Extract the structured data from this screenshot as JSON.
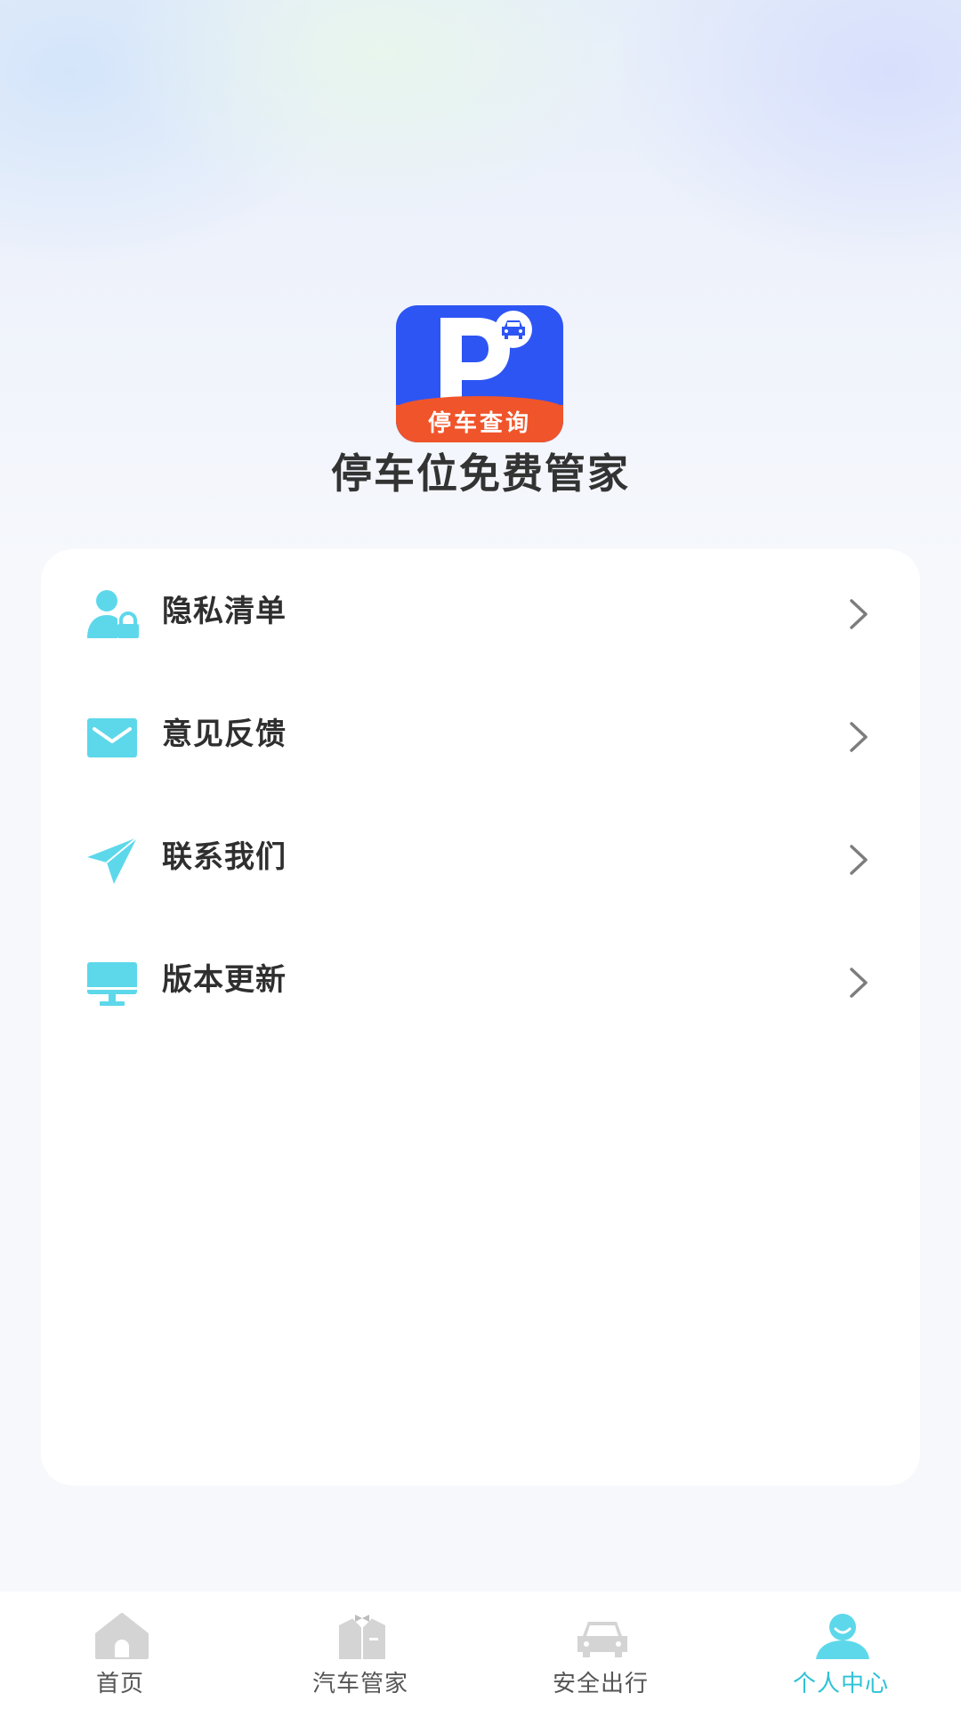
{
  "header": {
    "logo_text": "停车查询",
    "app_name": "停车位免费管家"
  },
  "menu": {
    "items": [
      {
        "label": "隐私清单",
        "icon": "privacy-user-lock-icon"
      },
      {
        "label": "意见反馈",
        "icon": "mail-envelope-icon"
      },
      {
        "label": "联系我们",
        "icon": "paper-plane-icon"
      },
      {
        "label": "版本更新",
        "icon": "monitor-icon"
      }
    ]
  },
  "tab_bar": {
    "tabs": [
      {
        "label": "首页",
        "icon": "home-icon",
        "active": false
      },
      {
        "label": "汽车管家",
        "icon": "butler-suit-icon",
        "active": false
      },
      {
        "label": "安全出行",
        "icon": "car-icon",
        "active": false
      },
      {
        "label": "个人中心",
        "icon": "person-icon",
        "active": true
      }
    ]
  },
  "colors": {
    "accent": "#5dd8ea",
    "active_tab": "#2dc2d6",
    "logo_blue": "#2d55f4",
    "logo_orange": "#f0542a"
  }
}
